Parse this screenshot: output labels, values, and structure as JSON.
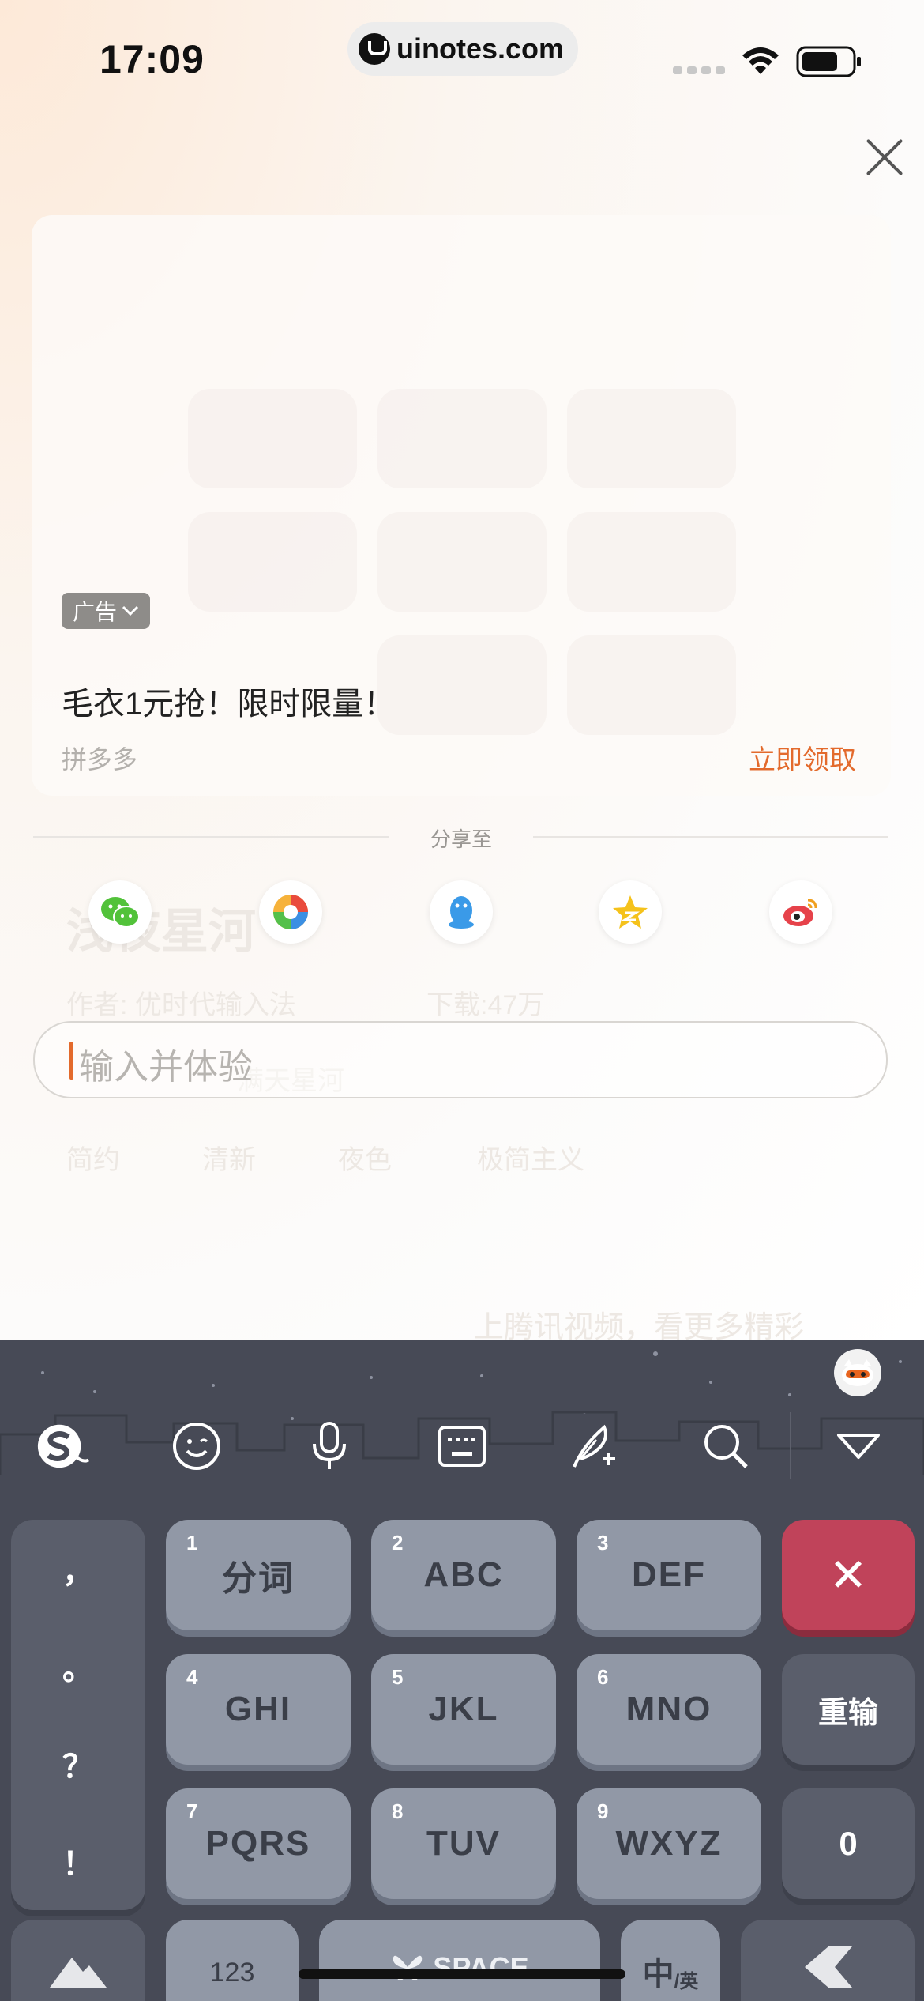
{
  "status_bar": {
    "time": "17:09",
    "url": "uinotes.com"
  },
  "ad": {
    "badge": "广告",
    "title": "毛衣1元抢！限时限量！",
    "source": "拼多多",
    "cta": "立即领取"
  },
  "share": {
    "label": "分享至",
    "targets": [
      "wechat-icon",
      "moments-icon",
      "qq-icon",
      "qzone-icon",
      "weibo-icon"
    ]
  },
  "input": {
    "placeholder": "输入并体验"
  },
  "background_page": {
    "title": "浅夜星河",
    "author": "作者: 优时代输入法",
    "downloads": "下载:47万",
    "desc": "满天星河",
    "tags": [
      "简约",
      "清新",
      "夜色",
      "极简主义"
    ],
    "promo": "上腾讯视频，看更多精彩"
  },
  "keyboard": {
    "toolbar": [
      "sogou-logo-icon",
      "emoji-icon",
      "microphone-icon",
      "keyboard-icon",
      "quill-icon",
      "search-icon",
      "collapse-icon"
    ],
    "punctuation": [
      "，",
      "。",
      "？",
      "！"
    ],
    "keys": [
      {
        "num": "1",
        "label": "分词"
      },
      {
        "num": "2",
        "label": "ABC"
      },
      {
        "num": "3",
        "label": "DEF"
      },
      {
        "num": "4",
        "label": "GHI"
      },
      {
        "num": "5",
        "label": "JKL"
      },
      {
        "num": "6",
        "label": "MNO"
      },
      {
        "num": "7",
        "label": "PQRS"
      },
      {
        "num": "8",
        "label": "TUV"
      },
      {
        "num": "9",
        "label": "WXYZ"
      }
    ],
    "delete_label": "✕",
    "reinput_label": "重输",
    "zero_label": "0",
    "bottom": {
      "num_mode": "123",
      "space": "SPACE",
      "lang_main": "中",
      "lang_sub": "/英"
    }
  }
}
